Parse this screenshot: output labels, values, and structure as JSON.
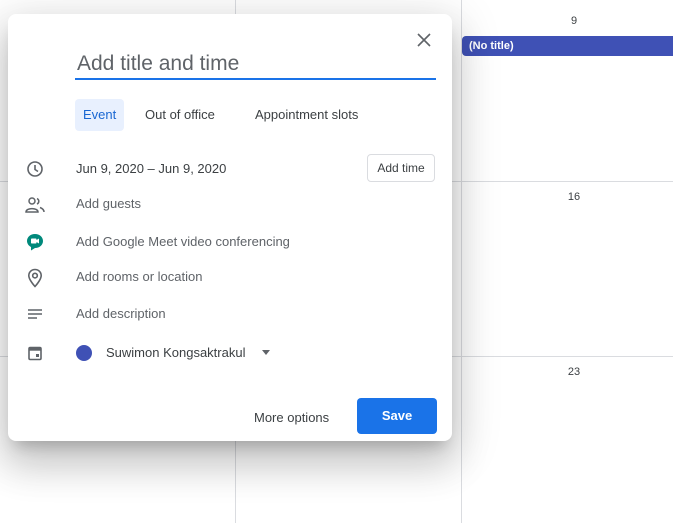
{
  "calendar": {
    "day_numbers": [
      "9",
      "16",
      "23"
    ],
    "event_chip_label": "(No title)",
    "event_color": "#3f51b5"
  },
  "dialog": {
    "title_placeholder": "Add title and time",
    "close_icon": "close-icon",
    "tabs": [
      {
        "label": "Event",
        "active": true
      },
      {
        "label": "Out of office",
        "active": false
      },
      {
        "label": "Appointment slots",
        "active": false
      }
    ],
    "date_range": "Jun 9, 2020  –  Jun 9, 2020",
    "add_time_label": "Add time",
    "rows": {
      "guests": "Add guests",
      "meet": "Add Google Meet video conferencing",
      "location": "Add rooms or location",
      "description": "Add description"
    },
    "calendar_owner": "Suwimon Kongsaktrakul",
    "owner_color": "#3f51b5",
    "more_options_label": "More options",
    "save_label": "Save"
  },
  "colors": {
    "accent": "#1a73e8",
    "meet_green": "#00897b",
    "tab_active_bg": "#e8f0fe"
  }
}
